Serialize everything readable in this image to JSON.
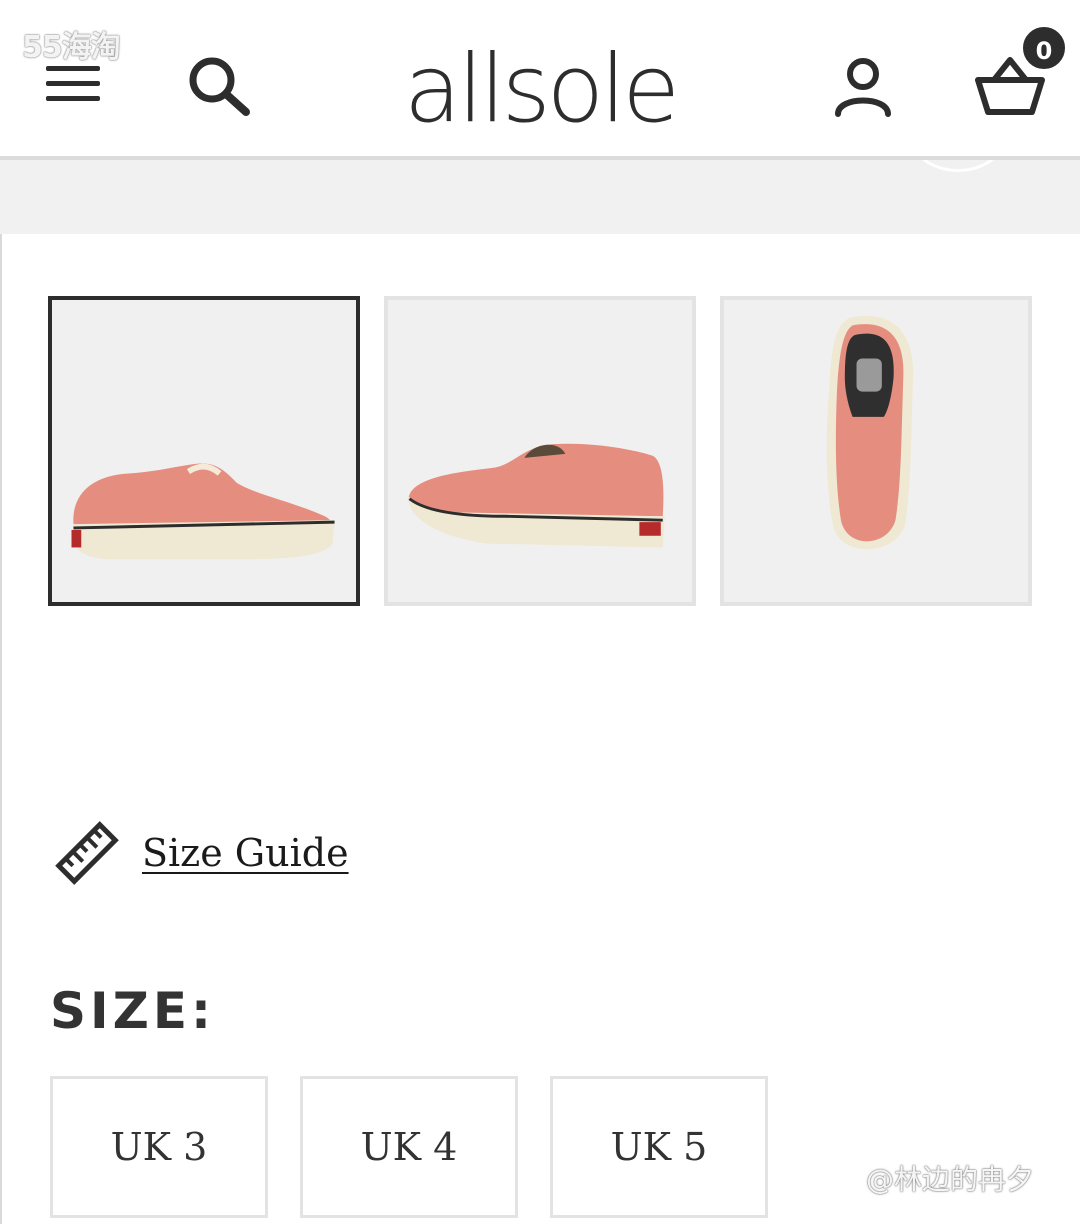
{
  "watermark_top": "55海淘",
  "watermark_bottom": "@林边的冉夕",
  "header": {
    "logo": "allsole",
    "basket_count": "0",
    "menu_icon": "hamburger-icon",
    "search_icon": "search-icon",
    "account_icon": "account-icon",
    "basket_icon": "basket-icon"
  },
  "gallery": {
    "thumbnails": [
      {
        "view": "side",
        "selected": true
      },
      {
        "view": "angle",
        "selected": false
      },
      {
        "view": "top",
        "selected": false
      }
    ],
    "shoe_color": "#e58d7f",
    "sole_color": "#efe8d3"
  },
  "size_guide": {
    "label": "Size Guide",
    "icon": "ruler-icon"
  },
  "size_section": {
    "heading": "SIZE:",
    "options": [
      "UK 3",
      "UK 4",
      "UK 5"
    ]
  },
  "colors": {
    "text": "#2d2d2d",
    "border": "#e3e3e3",
    "band": "#f1f1f1"
  }
}
